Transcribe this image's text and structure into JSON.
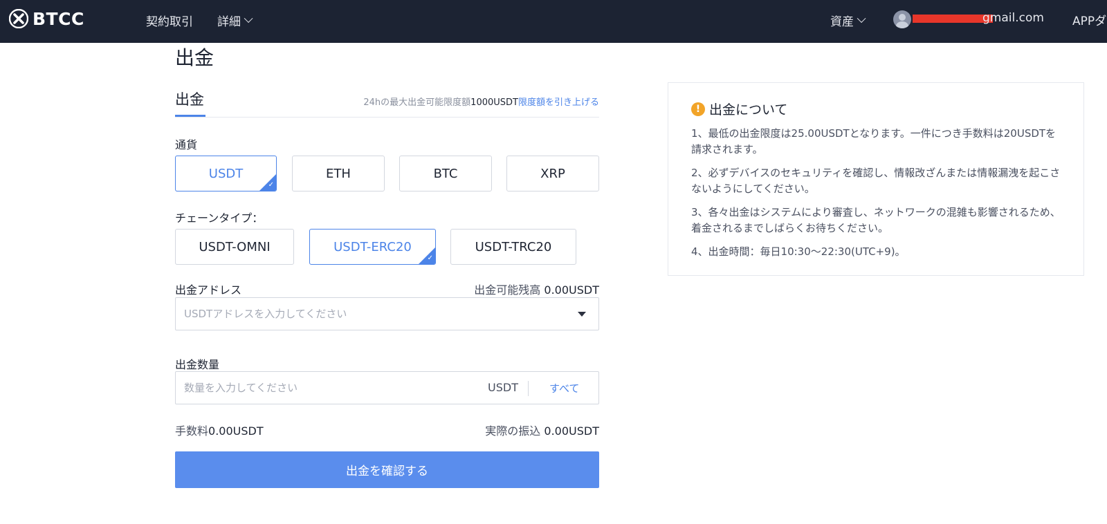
{
  "header": {
    "brand": "BTCC",
    "nav": [
      {
        "label": "契約取引"
      },
      {
        "label": "詳細"
      }
    ],
    "assets_label": "資産",
    "email_visible": "gmail.com",
    "app_label": "APPダ"
  },
  "page": {
    "title": "出金",
    "tab_label": "出金",
    "limit": {
      "prefix": "24hの最大出金可能限度額",
      "value": "1000USDT",
      "link": "限度額を引き上げる"
    }
  },
  "currency": {
    "label": "通貨",
    "options": [
      {
        "label": "USDT",
        "selected": true
      },
      {
        "label": "ETH",
        "selected": false
      },
      {
        "label": "BTC",
        "selected": false
      },
      {
        "label": "XRP",
        "selected": false
      }
    ]
  },
  "chain": {
    "label": "チェーンタイプ：",
    "options": [
      {
        "label": "USDT-OMNI",
        "selected": false
      },
      {
        "label": "USDT-ERC20",
        "selected": true
      },
      {
        "label": "USDT-TRC20",
        "selected": false
      }
    ]
  },
  "address": {
    "label": "出金アドレス",
    "balance_label": "出金可能残高",
    "balance_value": "0.00USDT",
    "placeholder": "USDTアドレスを入力してください",
    "value": ""
  },
  "amount": {
    "label": "出金数量",
    "placeholder": "数量を入力してください",
    "value": "",
    "unit": "USDT",
    "all_label": "すべて"
  },
  "fee": {
    "label": "手数料",
    "value": "0.00USDT",
    "actual_label": "実際の振込",
    "actual_value": "0.00USDT"
  },
  "submit_label": "出金を確認する",
  "notice": {
    "title": "出金について",
    "items": [
      "1、最低の出金限度は25.00USDTとなります。一件につき手数料は20USDTを請求されます。",
      "2、必ずデバイスのセキュリティを確認し、情報改ざんまたは情報漏洩を起こさないようにしてください。",
      "3、各々出金はシステムにより審査し、ネットワークの混雑も影響されるため、着金されるまでしばらくお待ちください。",
      "4、出金時間：毎日10:30〜22:30(UTC+9)。"
    ]
  },
  "colors": {
    "header_bg": "#1c2333",
    "accent": "#4c84e8",
    "button": "#5a8ded",
    "warning": "#f2a428",
    "redaction": "#e8362a"
  }
}
